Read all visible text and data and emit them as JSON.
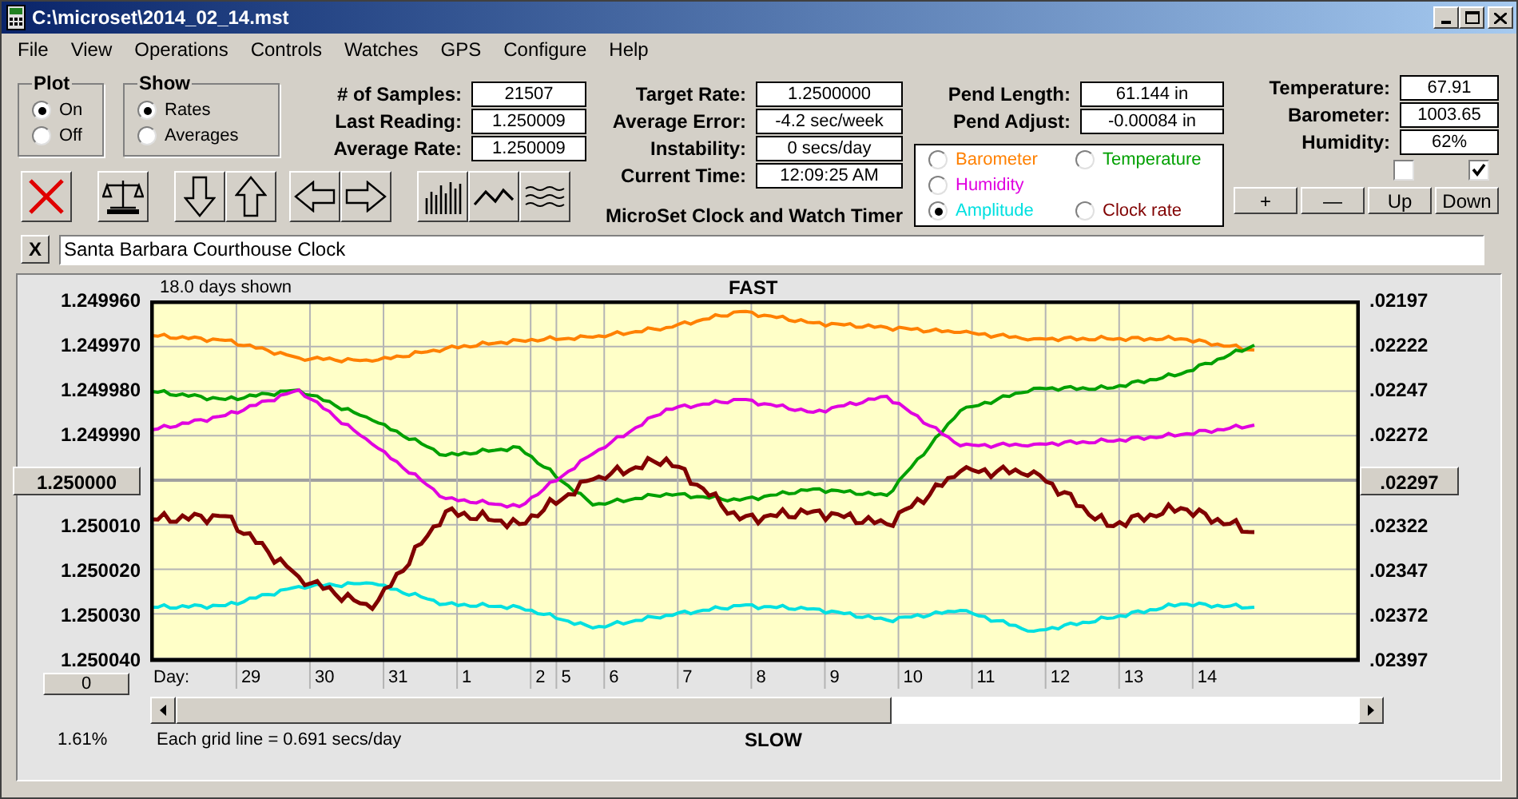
{
  "window": {
    "title": "C:\\microset\\2014_02_14.mst"
  },
  "menu": [
    "File",
    "View",
    "Operations",
    "Controls",
    "Watches",
    "GPS",
    "Configure",
    "Help"
  ],
  "plot_group": {
    "label": "Plot",
    "options": [
      {
        "label": "On",
        "selected": true
      },
      {
        "label": "Off",
        "selected": false
      }
    ]
  },
  "show_group": {
    "label": "Show",
    "options": [
      {
        "label": "Rates",
        "selected": true
      },
      {
        "label": "Averages",
        "selected": false
      }
    ]
  },
  "sample_fields": [
    {
      "label": "# of Samples:",
      "value": "21507"
    },
    {
      "label": "Last Reading:",
      "value": "1.250009"
    },
    {
      "label": "Average Rate:",
      "value": "1.250009"
    }
  ],
  "rate_fields": [
    {
      "label": "Target Rate:",
      "value": "1.2500000"
    },
    {
      "label": "Average Error:",
      "value": "-4.2 sec/week"
    },
    {
      "label": "Instability:",
      "value": "0 secs/day"
    },
    {
      "label": "Current Time:",
      "value": "12:09:25 AM"
    }
  ],
  "caption": "MicroSet Clock and Watch Timer",
  "pendulum_fields": [
    {
      "label": "Pend Length:",
      "value": "61.144 in"
    },
    {
      "label": "Pend Adjust:",
      "value": "-0.00084 in"
    }
  ],
  "legend": [
    [
      {
        "label": "Barometer",
        "color": "#ff8000",
        "selected": false
      },
      {
        "label": "Temperature",
        "color": "#00a000",
        "selected": false
      }
    ],
    [
      {
        "label": "Humidity",
        "color": "#e000e0",
        "selected": false
      }
    ],
    [
      {
        "label": "Amplitude",
        "color": "#00e0e0",
        "selected": true
      },
      {
        "label": "Clock rate",
        "color": "#800000",
        "selected": false
      }
    ]
  ],
  "environment_fields": [
    {
      "label": "Temperature:",
      "value": "67.91"
    },
    {
      "label": "Barometer:",
      "value": "1003.65"
    },
    {
      "label": "Humidity:",
      "value": "62%"
    }
  ],
  "environment_checkboxes": [
    {
      "checked": false
    },
    {
      "checked": true
    }
  ],
  "adjust_buttons": [
    "+",
    "—",
    "Up",
    "Down"
  ],
  "clear_button": "X",
  "title_field": {
    "value": "Santa Barbara Courthouse Clock"
  },
  "chart": {
    "days_shown": "18.0 days shown",
    "top_label": "FAST",
    "bottom_label": "SLOW",
    "day_caption": "Day:",
    "zero_button": "0",
    "percent": "1.61%",
    "grid_note": "Each grid line = 0.691 secs/day",
    "day_labels": [
      "29",
      "30",
      "31",
      "1",
      "2",
      "5",
      "6",
      "7",
      "8",
      "9",
      "10",
      "11",
      "12",
      "13",
      "14"
    ],
    "right_axis": [
      {
        "label": ".02197",
        "kind": "text"
      },
      {
        "label": ".02222",
        "kind": "text"
      },
      {
        "label": ".02247",
        "kind": "text"
      },
      {
        "label": ".02272",
        "kind": "text"
      },
      {
        "label": ".02297",
        "kind": "button"
      },
      {
        "label": ".02322",
        "kind": "text"
      },
      {
        "label": ".02347",
        "kind": "text"
      },
      {
        "label": ".02372",
        "kind": "text"
      },
      {
        "label": ".02397",
        "kind": "text"
      }
    ],
    "left_axis": [
      {
        "label": "1.249960",
        "kind": "text"
      },
      {
        "label": "1.249970",
        "kind": "text"
      },
      {
        "label": "1.249980",
        "kind": "text"
      },
      {
        "label": "1.249990",
        "kind": "text"
      },
      {
        "label": "1.250000",
        "kind": "button"
      },
      {
        "label": "1.250010",
        "kind": "text"
      },
      {
        "label": "1.250020",
        "kind": "text"
      },
      {
        "label": "1.250030",
        "kind": "text"
      },
      {
        "label": "1.250040",
        "kind": "text"
      }
    ]
  }
}
